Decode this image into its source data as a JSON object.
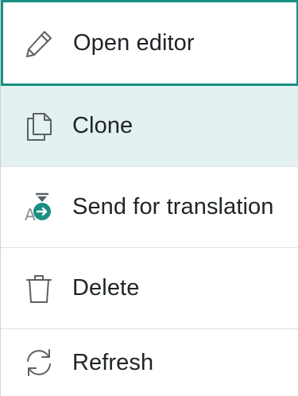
{
  "menu": {
    "items": [
      {
        "label": "Open editor",
        "icon": "pencil-icon",
        "state": "focused"
      },
      {
        "label": "Clone",
        "icon": "copy-icon",
        "state": "hovered"
      },
      {
        "label": "Send for translation",
        "icon": "translate-icon",
        "state": "normal"
      },
      {
        "label": "Delete",
        "icon": "trash-icon",
        "state": "normal"
      },
      {
        "label": "Refresh",
        "icon": "refresh-icon",
        "state": "normal"
      }
    ]
  },
  "colors": {
    "focus_border": "#1a8f82",
    "hover_background": "#e3f1f0",
    "icon_stroke": "#5b6166",
    "accent_teal": "#1a8f82",
    "text": "#1f2428"
  }
}
